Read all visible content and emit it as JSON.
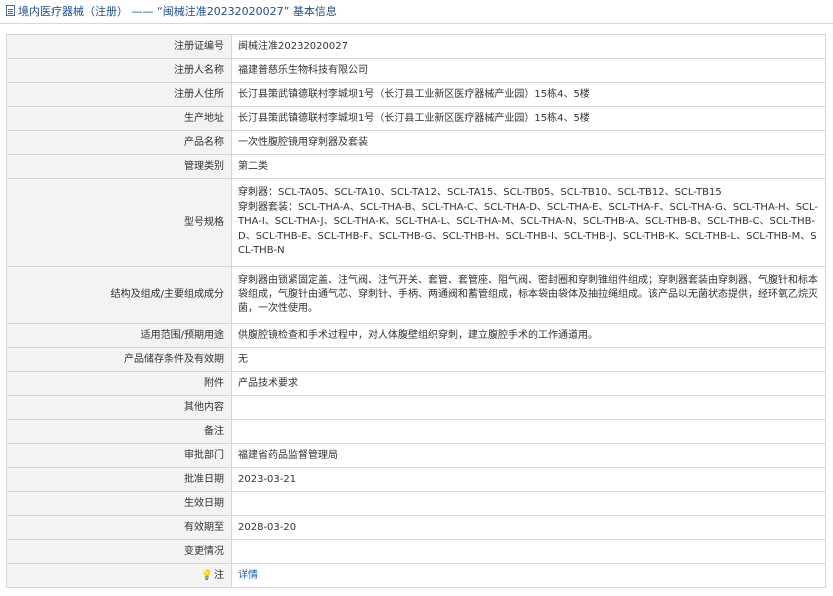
{
  "header": {
    "title": "境内医疗器械（注册） —— “闽械注准20232020027” 基本信息"
  },
  "rows": [
    {
      "label": "注册证编号",
      "value": "闽械注准20232020027"
    },
    {
      "label": "注册人名称",
      "value": "福建普慈乐生物科技有限公司"
    },
    {
      "label": "注册人住所",
      "value": "长汀县策武镇德联村李城坝1号（长汀县工业新区医疗器械产业园）15栋4、5楼"
    },
    {
      "label": "生产地址",
      "value": "长汀县策武镇德联村李城坝1号（长汀县工业新区医疗器械产业园）15栋4、5楼"
    },
    {
      "label": "产品名称",
      "value": "一次性腹腔镜用穿刺器及套装"
    },
    {
      "label": "管理类别",
      "value": "第二类"
    },
    {
      "label": "型号规格",
      "value": "穿刺器：SCL-TA05、SCL-TA10、SCL-TA12、SCL-TA15、SCL-TB05、SCL-TB10、SCL-TB12、SCL-TB15",
      "value2": "穿刺器套装：SCL-THA-A、SCL-THA-B、SCL-THA-C、SCL-THA-D、SCL-THA-E、SCL-THA-F、SCL-THA-G、SCL-THA-H、SCL-THA-I、SCL-THA-J、SCL-THA-K、SCL-THA-L、SCL-THA-M、SCL-THA-N、SCL-THB-A、SCL-THB-B、SCL-THB-C、SCL-THB-D、SCL-THB-E、SCL-THB-F、SCL-THB-G、SCL-THB-H、SCL-THB-I、SCL-THB-J、SCL-THB-K、SCL-THB-L、SCL-THB-M、SCL-THB-N"
    },
    {
      "label": "结构及组成/主要组成成分",
      "value": "穿刺器由锁紧固定盖、注气阀、注气开关、套管、套管座、阻气阀、密封圈和穿刺锥组件组成；穿刺器套装由穿刺器、气腹针和标本袋组成，气腹针由通气芯、穿刺针、手柄、两通阀和蓄管组成，标本袋由袋体及抽拉绳组成。该产品以无菌状态提供，经环氧乙烷灭菌，一次性使用。"
    },
    {
      "label": "适用范围/预期用途",
      "value": "供腹腔镜检查和手术过程中，对人体腹壁组织穿刺，建立腹腔手术的工作通道用。"
    },
    {
      "label": "产品储存条件及有效期",
      "value": "无"
    },
    {
      "label": "附件",
      "value": "产品技术要求"
    },
    {
      "label": "其他内容",
      "value": ""
    },
    {
      "label": "备注",
      "value": ""
    },
    {
      "label": "审批部门",
      "value": "福建省药品监督管理局"
    },
    {
      "label": "批准日期",
      "value": "2023-03-21"
    },
    {
      "label": "生效日期",
      "value": ""
    },
    {
      "label": "有效期至",
      "value": "2028-03-20"
    },
    {
      "label": "变更情况",
      "value": ""
    },
    {
      "label": "注",
      "value": "详情"
    }
  ],
  "icons": {
    "note": "lightbulb-icon",
    "header": "document-icon"
  },
  "colors": {
    "link": "#1a5fb4",
    "label_bg": "#f3f3f3",
    "header_text": "#1f4e8c"
  }
}
